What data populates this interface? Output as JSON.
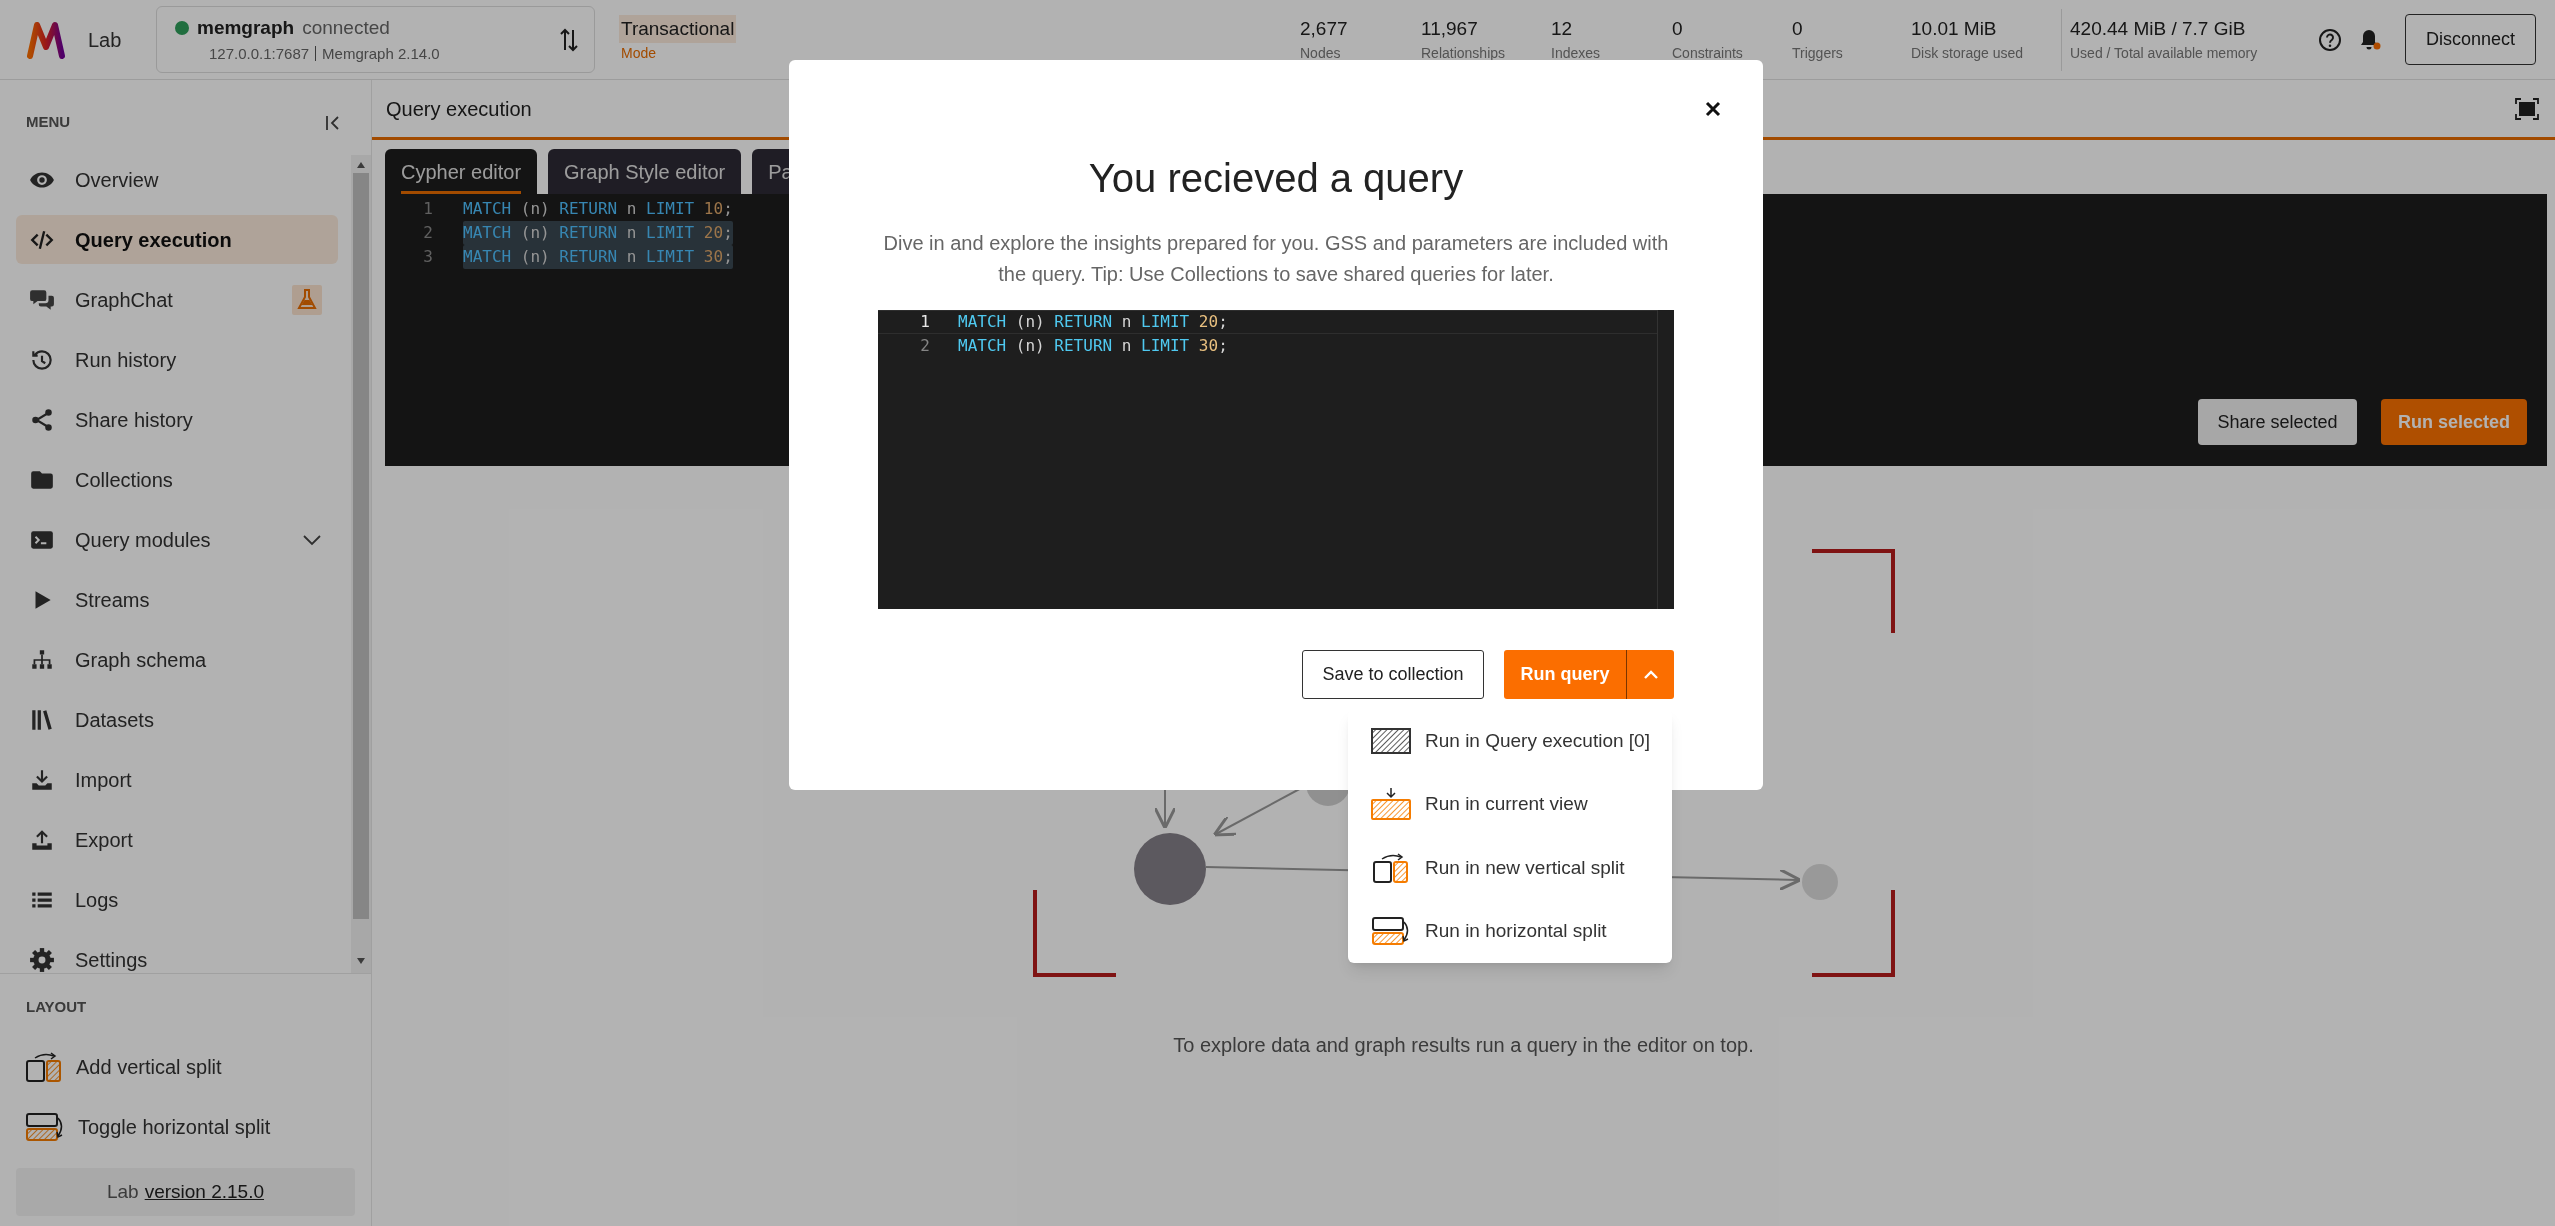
{
  "header": {
    "app_name": "Lab",
    "connection": {
      "name": "memgraph",
      "status": "connected",
      "connected": true,
      "address": "127.0.0.1:7687",
      "version": "Memgraph 2.14.0"
    },
    "mode": {
      "value": "Transactional",
      "label": "Mode"
    },
    "stats": [
      {
        "value": "2,677",
        "label": "Nodes"
      },
      {
        "value": "11,967",
        "label": "Relationships"
      },
      {
        "value": "12",
        "label": "Indexes"
      },
      {
        "value": "0",
        "label": "Constraints"
      },
      {
        "value": "0",
        "label": "Triggers"
      },
      {
        "value": "10.01 MiB",
        "label": "Disk storage used"
      }
    ],
    "memory": {
      "value": "420.44 MiB / 7.7 GiB",
      "label": "Used / Total available memory"
    },
    "disconnect_button": "Disconnect"
  },
  "sidebar": {
    "menu_label": "MENU",
    "items": [
      {
        "label": "Overview",
        "kind": "link",
        "selected": false
      },
      {
        "label": "Query execution",
        "kind": "link",
        "selected": true
      },
      {
        "label": "GraphChat",
        "kind": "beta",
        "selected": false
      },
      {
        "label": "Run history",
        "kind": "link",
        "selected": false
      },
      {
        "label": "Share history",
        "kind": "link",
        "selected": false
      },
      {
        "label": "Collections",
        "kind": "link",
        "selected": false
      },
      {
        "label": "Query modules",
        "kind": "group",
        "selected": false
      },
      {
        "label": "Streams",
        "kind": "link",
        "selected": false
      },
      {
        "label": "Graph schema",
        "kind": "link",
        "selected": false
      },
      {
        "label": "Datasets",
        "kind": "link",
        "selected": false
      },
      {
        "label": "Import",
        "kind": "link",
        "selected": false
      },
      {
        "label": "Export",
        "kind": "link",
        "selected": false
      },
      {
        "label": "Logs",
        "kind": "link",
        "selected": false
      },
      {
        "label": "Settings",
        "kind": "link",
        "selected": false
      }
    ],
    "layout_label": "LAYOUT",
    "layout_items": [
      {
        "label": "Add vertical split"
      },
      {
        "label": "Toggle horizontal split"
      }
    ],
    "footer": {
      "prefix": "Lab",
      "version_link": "version 2.15.0"
    }
  },
  "main": {
    "title": "Query execution",
    "tabs": [
      {
        "label": "Cypher editor",
        "selected": true
      },
      {
        "label": "Graph Style editor",
        "selected": false
      },
      {
        "label": "Pa",
        "selected": false
      }
    ],
    "editor_lines": [
      {
        "number": "1",
        "code": "MATCH (n) RETURN n LIMIT 10;",
        "selected": false
      },
      {
        "number": "2",
        "code": "MATCH (n) RETURN n LIMIT 20;",
        "selected": true
      },
      {
        "number": "3",
        "code": "MATCH (n) RETURN n LIMIT 30;",
        "selected": true
      }
    ],
    "share_button": "Share selected",
    "run_button": "Run selected",
    "empty_message": "To explore data and graph results run a query in the editor on top."
  },
  "modal": {
    "title": "You recieved a query",
    "description": "Dive in and explore the insights prepared for you. GSS and parameters are included with the query. Tip: Use Collections to save shared queries for later.",
    "code_lines": [
      {
        "number": "1",
        "code": "MATCH (n) RETURN n LIMIT 20;",
        "current": true
      },
      {
        "number": "2",
        "code": "MATCH (n) RETURN n LIMIT 30;",
        "current": false
      }
    ],
    "save_button": "Save to collection",
    "run_button": "Run query",
    "run_menu": [
      {
        "label": "Run in Query execution [0]"
      },
      {
        "label": "Run in current view"
      },
      {
        "label": "Run in new vertical split"
      },
      {
        "label": "Run in horizontal split"
      }
    ]
  }
}
